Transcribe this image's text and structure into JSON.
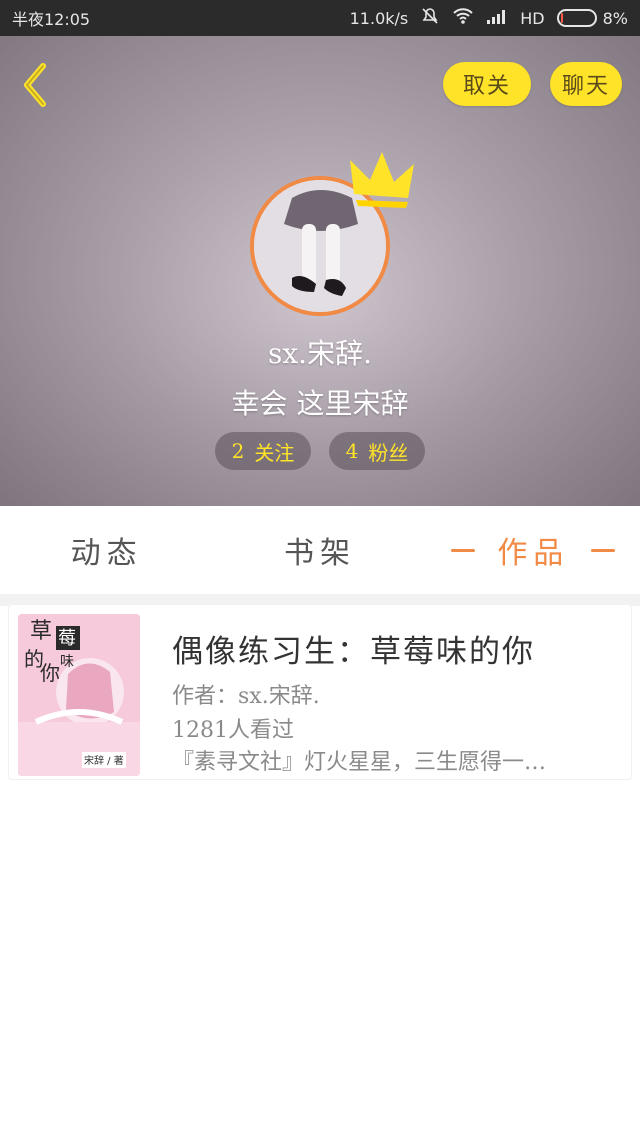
{
  "status_bar": {
    "time": "半夜12:05",
    "network_speed": "11.0k/s",
    "network_type": "HD",
    "battery_percent": "8%",
    "battery_level": 0.08,
    "icons": [
      "mute-icon",
      "wifi-icon",
      "signal-icon"
    ]
  },
  "header": {
    "back_icon": "chevron-left-icon",
    "unfollow_label": "取关",
    "chat_label": "聊天",
    "username": "sx.宋辞.",
    "bio": "幸会 这里宋辞",
    "following": {
      "count": "2",
      "label": "关注"
    },
    "followers": {
      "count": "4",
      "label": "粉丝"
    },
    "crown_icon": "crown-icon",
    "colors": {
      "accent": "#ffe328",
      "avatar_border": "#f08a45"
    }
  },
  "tabs": {
    "items": [
      {
        "label": "动态"
      },
      {
        "label": "书架"
      },
      {
        "label": "作品"
      }
    ],
    "active_index": 2,
    "active_color": "#f08a45"
  },
  "books": [
    {
      "title": "偶像练习生：草莓味的你",
      "author": "作者：sx.宋辞.",
      "reads": "1281人看过",
      "description": "『素寻文社』灯火星星，三生愿得一…",
      "cover": {
        "title_line1": "草",
        "title_line2": "莓",
        "title_line3": "味",
        "title_line4": "的",
        "title_line5": "你",
        "badge": "宋辞 / 著"
      }
    }
  ]
}
